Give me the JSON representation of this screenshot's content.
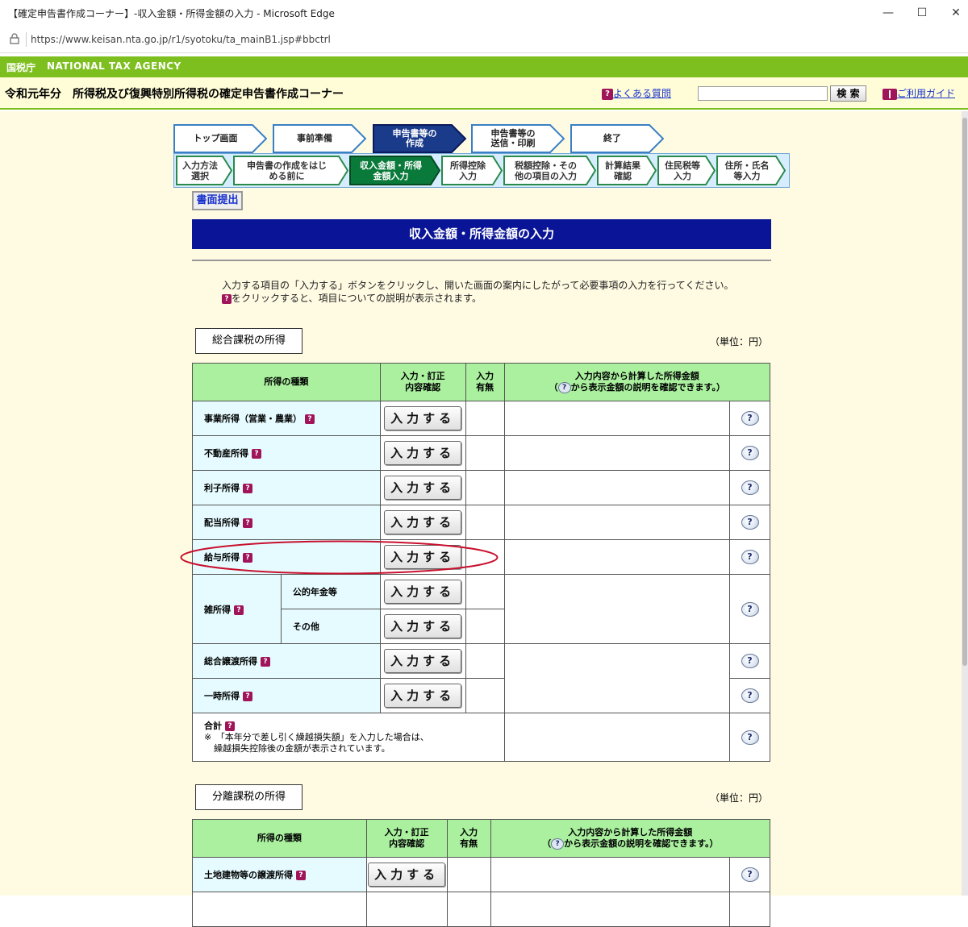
{
  "window": {
    "title": "【確定申告書作成コーナー】-収入金額・所得金額の入力 - Microsoft Edge",
    "controls": {
      "minimize": "—",
      "maximize": "☐",
      "close": "✕"
    },
    "url": "https://www.keisan.nta.go.jp/r1/syotoku/ta_mainB1.jsp#bbctrl"
  },
  "agency": {
    "name_ja": "国税庁",
    "name_en": "NATIONAL TAX AGENCY"
  },
  "header": {
    "corner_title": "令和元年分　所得税及び復興特別所得税の確定申告書作成コーナー",
    "faq_label": "よくある質問",
    "search_placeholder": "",
    "search_button": "検 索",
    "guide_label": "ご利用ガイド"
  },
  "steps": [
    {
      "label": "トップ画面",
      "active": false
    },
    {
      "label": "事前準備",
      "active": false
    },
    {
      "label": "申告書等の\n作成",
      "active": true
    },
    {
      "label": "申告書等の\n送信・印刷",
      "active": false
    },
    {
      "label": "終了",
      "active": false
    }
  ],
  "substeps": [
    {
      "label": "入力方法\n選択",
      "active": false
    },
    {
      "label": "申告書の作成をはじ\nめる前に",
      "active": false
    },
    {
      "label": "収入金額・所得\n金額入力",
      "active": true
    },
    {
      "label": "所得控除\n入力",
      "active": false
    },
    {
      "label": "税額控除・その\n他の項目の入力",
      "active": false
    },
    {
      "label": "計算結果\n確認",
      "active": false
    },
    {
      "label": "住民税等\n入力",
      "active": false
    },
    {
      "label": "住所・氏名\n等入力",
      "active": false
    }
  ],
  "submit_doc_label": "書面提出",
  "page_title": "収入金額・所得金額の入力",
  "instructions": {
    "line1": "入力する項目の「入力する」ボタンをクリックし、開いた画面の案内にしたがって必要事項の入力を行ってください。",
    "line2": "をクリックすると、項目についての説明が表示されます。"
  },
  "sections": {
    "comprehensive": {
      "tab": "総合課税の所得",
      "unit": "（単位：円）"
    },
    "separate": {
      "tab": "分離課税の所得",
      "unit": "（単位：円）"
    }
  },
  "table_headers": {
    "type": "所得の種類",
    "confirm": "入力・訂正\n内容確認",
    "has_input": "入力\n有無",
    "amount_line1": "入力内容から計算した所得金額",
    "amount_line2_pre": "（",
    "amount_line2_post": "から表示金額の説明を確認できます。）"
  },
  "enter_button_label": "入力する",
  "help_glyph": "?",
  "income_rows": [
    {
      "label": "事業所得（営業・農業）"
    },
    {
      "label": "不動産所得"
    },
    {
      "label": "利子所得"
    },
    {
      "label": "配当所得"
    },
    {
      "label": "給与所得"
    }
  ],
  "misc_income": {
    "label": "雑所得",
    "subs": [
      {
        "label": "公的年金等"
      },
      {
        "label": "その他"
      }
    ]
  },
  "income_rows2": [
    {
      "label": "総合譲渡所得"
    },
    {
      "label": "一時所得"
    }
  ],
  "total": {
    "label": "合計",
    "note_line1": "※　「本年分で差し引く繰越損失額」を入力した場合は、",
    "note_line2": "繰越損失控除後の金額が表示されています。"
  },
  "separate_rows": [
    {
      "label": "土地建物等の譲渡所得"
    }
  ],
  "colors": {
    "agency_bar": "#7dbf1e",
    "header_bg": "#fffdd8",
    "title_bar": "#0a1496",
    "table_header": "#aaf09f",
    "row_label_bg": "#e5fbff",
    "active_step": "#1a3a8a",
    "active_substep": "#0a7a3a",
    "highlight_ellipse": "#c8102e"
  }
}
